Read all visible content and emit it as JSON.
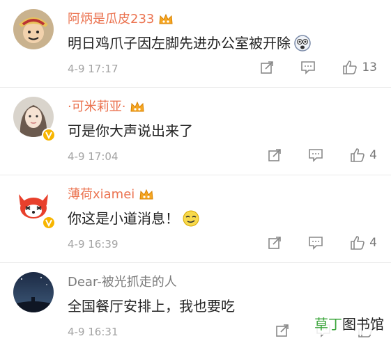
{
  "comments": [
    {
      "name": "阿炳是瓜皮233",
      "text": "明日鸡爪子因左脚先进办公室被开除",
      "time": "4-9 17:17",
      "likes": "13",
      "emoji": "scared-face-icon"
    },
    {
      "name": "·可米莉亚·",
      "text": "可是你大声说出来了",
      "time": "4-9 17:04",
      "likes": "4"
    },
    {
      "name": "薄荷xiamei",
      "text": "你这是小道消息！",
      "time": "4-9 16:39",
      "likes": "4",
      "emoji": "smirk-face-icon"
    },
    {
      "name": "Dear-被光抓走的人",
      "text": "全国餐厅安排上，我也要吃",
      "time": "4-9 16:31",
      "likes": ""
    }
  ],
  "watermark": {
    "part1": "草丁",
    "part2": "图书馆"
  },
  "colors": {
    "vip_name": "#eb7350",
    "normal_name": "#7a7a7a",
    "vip_badge": "#f7b500",
    "icon": "#888888"
  }
}
